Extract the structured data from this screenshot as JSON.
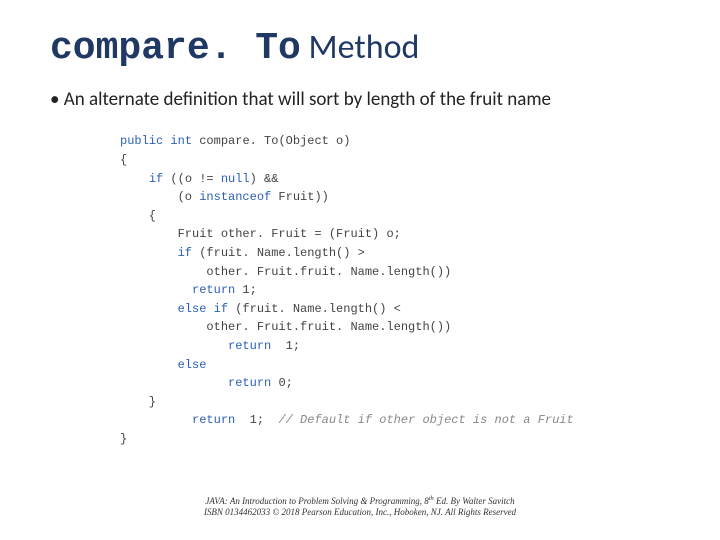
{
  "title": {
    "mono": "compare. To",
    "rest": " Method"
  },
  "bullet": "• An alternate definition that will sort by length of the fruit name",
  "code": {
    "l1a": "public",
    "l1b": " ",
    "l1c": "int",
    "l1d": " compare. To(Object o)",
    "l2": "{",
    "l3a": "    ",
    "l3b": "if",
    "l3c": " ((o != ",
    "l3d": "null",
    "l3e": ") &&",
    "l4a": "        (o ",
    "l4b": "instanceof",
    "l4c": " Fruit))",
    "l5": "    {",
    "l6": "        Fruit other. Fruit = (Fruit) o;",
    "l7a": "        ",
    "l7b": "if",
    "l7c": " (fruit. Name.length() >",
    "l8": "            other. Fruit.fruit. Name.length())",
    "l9a": "          ",
    "l9b": "return",
    "l9c": " 1;",
    "l10a": "        ",
    "l10b": "else if",
    "l10c": " (fruit. Name.length() <",
    "l11": "            other. Fruit.fruit. Name.length())",
    "l12a": "               ",
    "l12b": "return",
    "l12c": "  1;",
    "l13a": "        ",
    "l13b": "else",
    "l14a": "               ",
    "l14b": "return",
    "l14c": " 0;",
    "l15": "    }",
    "l16a": "          ",
    "l16b": "return",
    "l16c": "  1;  ",
    "l16d": "// Default if other object is not a Fruit",
    "l17": "}"
  },
  "footer": {
    "line1_a": "JAVA: An Introduction to Problem Solving & Programming, 8",
    "line1_b": " Ed. By Walter Savitch",
    "sup": "th",
    "line2": "ISBN 0134462033  © 2018 Pearson Education, Inc., Hoboken, NJ. All Rights Reserved"
  }
}
